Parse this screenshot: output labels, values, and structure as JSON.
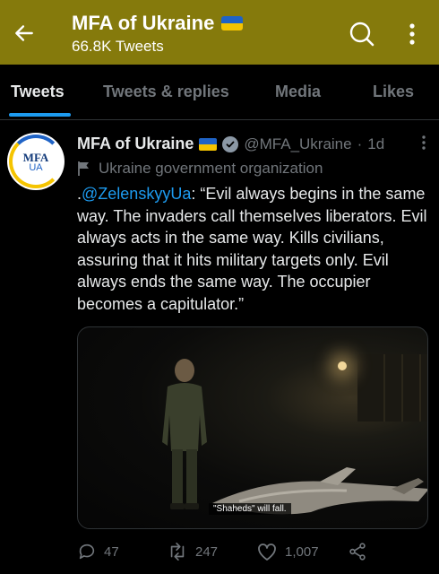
{
  "header": {
    "title": "MFA of Ukraine",
    "subtitle": "66.8K Tweets",
    "background_color": "#857a0c",
    "back_icon": "arrow-left-icon",
    "search_icon": "search-icon",
    "more_icon": "more-vertical-icon"
  },
  "tabs": [
    {
      "label": "Tweets",
      "active": true
    },
    {
      "label": "Tweets & replies",
      "active": false
    },
    {
      "label": "Media",
      "active": false
    },
    {
      "label": "Likes",
      "active": false
    }
  ],
  "tweet": {
    "avatar": {
      "line1": "MFA",
      "line2": "UA"
    },
    "display_name": "MFA of Ukraine",
    "handle": "@MFA_Ukraine",
    "separator": "·",
    "time": "1d",
    "org_label": "Ukraine government organization",
    "text_prefix": ".",
    "mention": "@ZelenskyyUa",
    "text_body": ": “Evil always begins in the same way. The invaders call themselves liberators. Evil always acts in the same way. Kills civilians, assuring that it hits military targets only. Evil always ends the same way. The occupier becomes a capitulator.”",
    "media_caption": "\"Shaheds\" will fall.",
    "actions": {
      "replies": "47",
      "retweets": "247",
      "likes": "1,007"
    }
  },
  "colors": {
    "accent": "#1d9bf0",
    "muted_text": "#71767b",
    "flag_blue": "#1f63c6",
    "flag_yellow": "#f5c400"
  }
}
